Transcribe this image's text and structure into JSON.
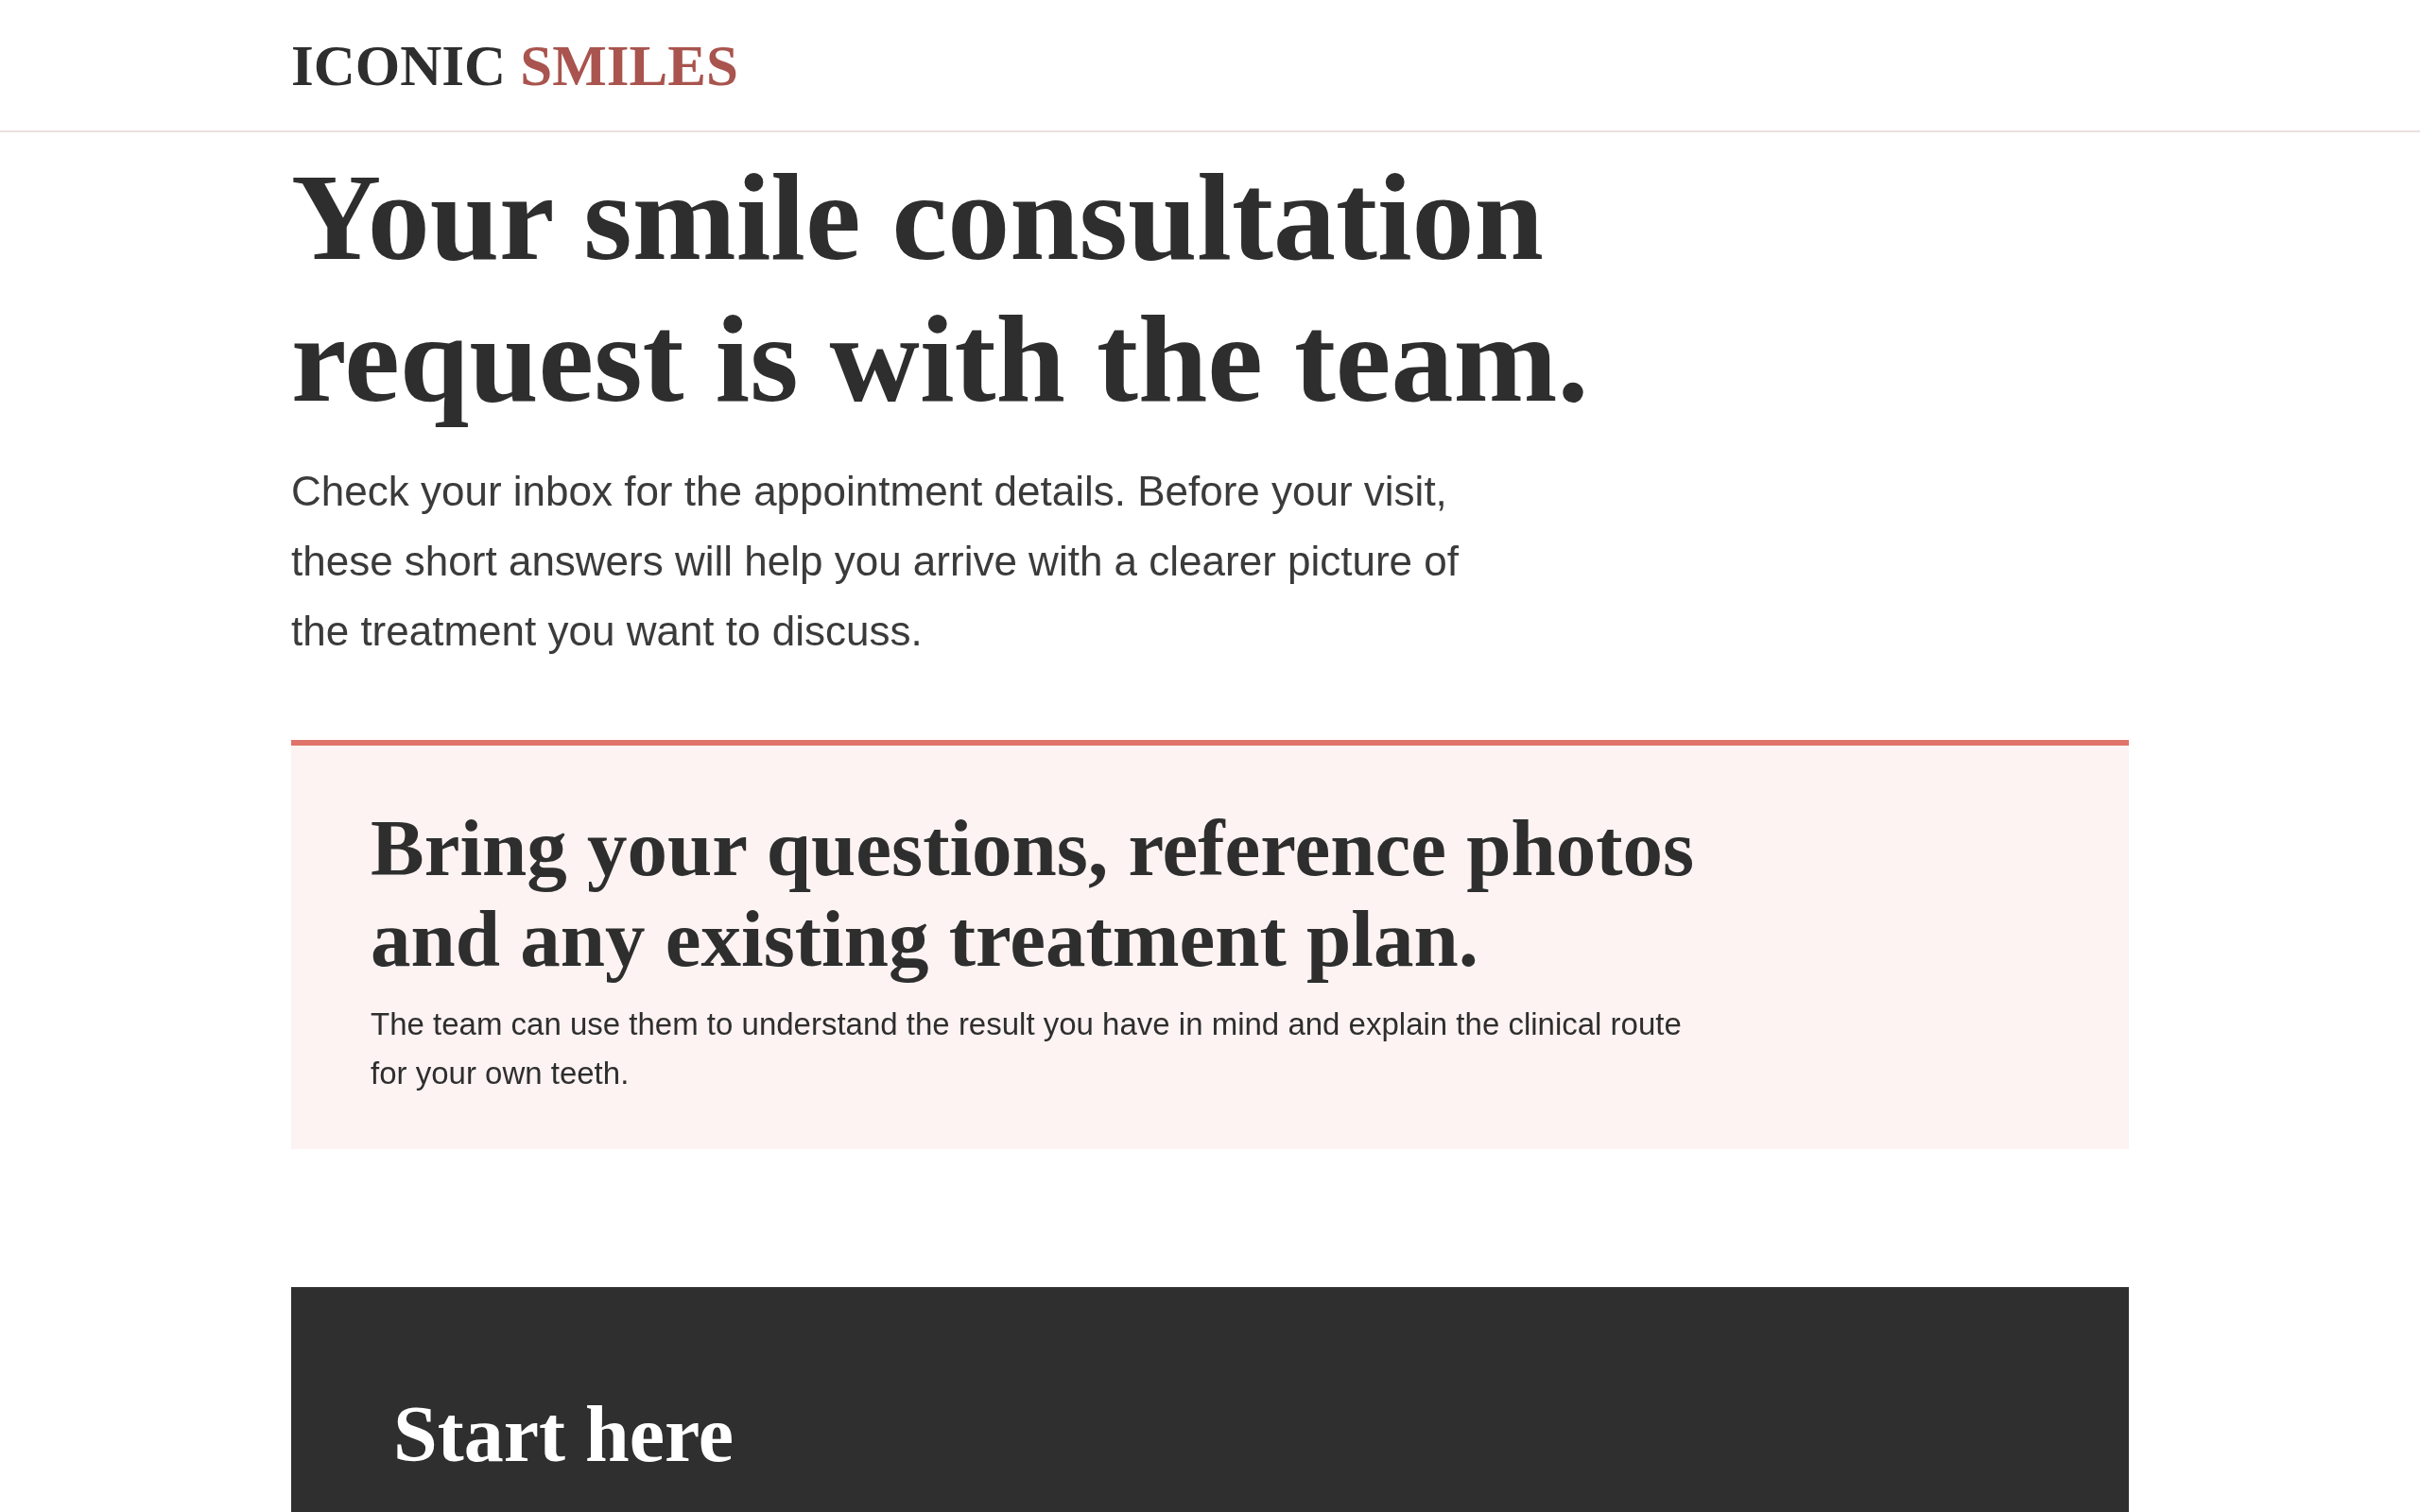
{
  "header": {
    "logo": {
      "primary": "ICONIC",
      "accent": "SMILES"
    }
  },
  "hero": {
    "title": "Your smile consultation request is with the team.",
    "intro": "Check your inbox for the appointment details. Before your visit, these short answers will help you arrive with a clearer picture of the treatment you want to discuss."
  },
  "callout": {
    "title": "Bring your questions, reference photos and any existing treatment plan.",
    "text": "The team can use them to understand the result you have in mind and explain the clinical route for your own teeth."
  },
  "next_section": {
    "title": "Start here"
  }
}
